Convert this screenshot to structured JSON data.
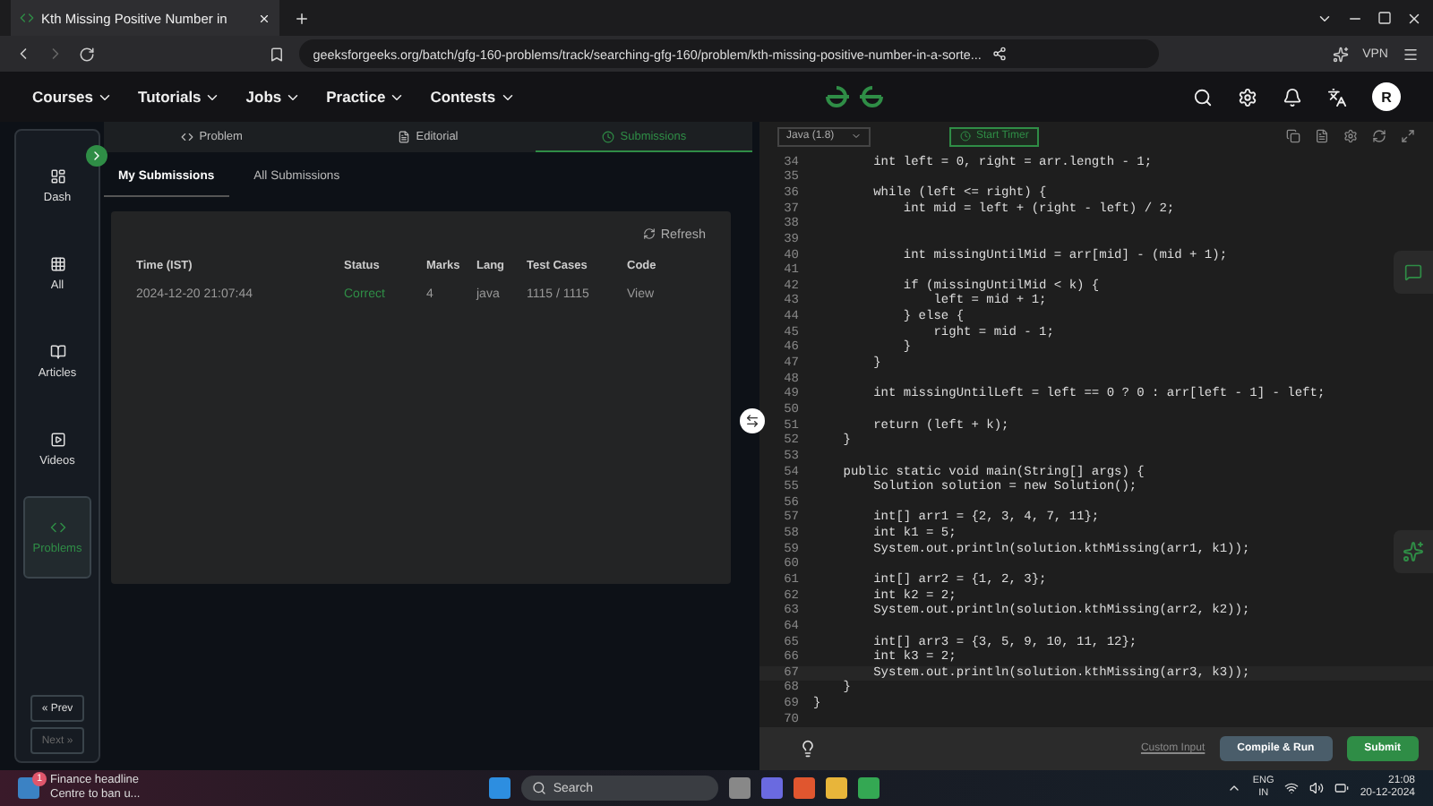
{
  "browser": {
    "tab_title": "Kth Missing Positive Number in",
    "url": "geeksforgeeks.org/batch/gfg-160-problems/track/searching-gfg-160/problem/kth-missing-positive-number-in-a-sorte...",
    "vpn": "VPN"
  },
  "site_nav": {
    "items": [
      "Courses",
      "Tutorials",
      "Jobs",
      "Practice",
      "Contests"
    ],
    "avatar": "R"
  },
  "sidebar": {
    "items": [
      {
        "label": "Dash",
        "selected": false
      },
      {
        "label": "All",
        "selected": false
      },
      {
        "label": "Articles",
        "selected": false
      },
      {
        "label": "Videos",
        "selected": false
      },
      {
        "label": "Problems",
        "selected": true
      }
    ],
    "prev": {
      "label": "« Prev",
      "disabled": false
    },
    "next": {
      "label": "Next »",
      "disabled": true
    }
  },
  "problem_tabs": [
    {
      "label": "Problem",
      "selected": false
    },
    {
      "label": "Editorial",
      "selected": false
    },
    {
      "label": "Submissions",
      "selected": true
    }
  ],
  "submission_tabs": [
    {
      "label": "My Submissions",
      "selected": true
    },
    {
      "label": "All Submissions",
      "selected": false
    }
  ],
  "refresh": "Refresh",
  "table": {
    "columns": [
      "Time (IST)",
      "Status",
      "Marks",
      "Lang",
      "Test Cases",
      "Code"
    ],
    "rows": [
      {
        "time": "2024-12-20 21:07:44",
        "status": "Correct",
        "marks": "4",
        "lang": "java",
        "test_cases": "1115 / 1115",
        "code": "View"
      }
    ]
  },
  "editor": {
    "language": "Java (1.8)",
    "timer": "Start Timer",
    "lines": [
      {
        "n": "34",
        "text": "        int left = 0, right = arr.length - 1;"
      },
      {
        "n": "35"
      },
      {
        "n": "36",
        "text": "        while (left <= right) {"
      },
      {
        "n": "37",
        "text": "            int mid = left + (right - left) / 2;"
      },
      {
        "n": "38"
      },
      {
        "n": "39"
      },
      {
        "n": "40",
        "text": "            int missingUntilMid = arr[mid] - (mid + 1);"
      },
      {
        "n": "41"
      },
      {
        "n": "42",
        "text": "            if (missingUntilMid < k) {"
      },
      {
        "n": "43",
        "text": "                left = mid + 1;"
      },
      {
        "n": "44",
        "text": "            } else {"
      },
      {
        "n": "45",
        "text": "                right = mid - 1;"
      },
      {
        "n": "46",
        "text": "            }"
      },
      {
        "n": "47",
        "text": "        }"
      },
      {
        "n": "48"
      },
      {
        "n": "49",
        "text": "        int missingUntilLeft = left == 0 ? 0 : arr[left - 1] - left;"
      },
      {
        "n": "50"
      },
      {
        "n": "51",
        "text": "        return (left + k);"
      },
      {
        "n": "52",
        "text": "    }"
      },
      {
        "n": "53"
      },
      {
        "n": "54",
        "text": "    public static void main(String[] args) {"
      },
      {
        "n": "55",
        "text": "        Solution solution = new Solution();"
      },
      {
        "n": "56"
      },
      {
        "n": "57",
        "text": "        int[] arr1 = {2, 3, 4, 7, 11};"
      },
      {
        "n": "58",
        "text": "        int k1 = 5;"
      },
      {
        "n": "59",
        "text": "        System.out.println(solution.kthMissing(arr1, k1));"
      },
      {
        "n": "60"
      },
      {
        "n": "61",
        "text": "        int[] arr2 = {1, 2, 3};"
      },
      {
        "n": "62",
        "text": "        int k2 = 2;"
      },
      {
        "n": "63",
        "text": "        System.out.println(solution.kthMissing(arr2, k2));"
      },
      {
        "n": "64"
      },
      {
        "n": "65",
        "text": "        int[] arr3 = {3, 5, 9, 10, 11, 12};"
      },
      {
        "n": "66",
        "text": "        int k3 = 2;"
      },
      {
        "n": "67",
        "text": "        System.out.println(solution.kthMissing(arr3, k3));"
      },
      {
        "n": "68",
        "text": "    }"
      },
      {
        "n": "69",
        "text": "}"
      },
      {
        "n": "70"
      }
    ],
    "custom_input": "Custom Input",
    "compile": "Compile & Run",
    "submit": "Submit"
  },
  "taskbar": {
    "news_title": "Finance headline",
    "news_text": "Centre to ban u...",
    "badge": "1",
    "search": "Search",
    "lang": "ENG",
    "region": "IN",
    "time": "21:08",
    "date": "20-12-2024"
  }
}
